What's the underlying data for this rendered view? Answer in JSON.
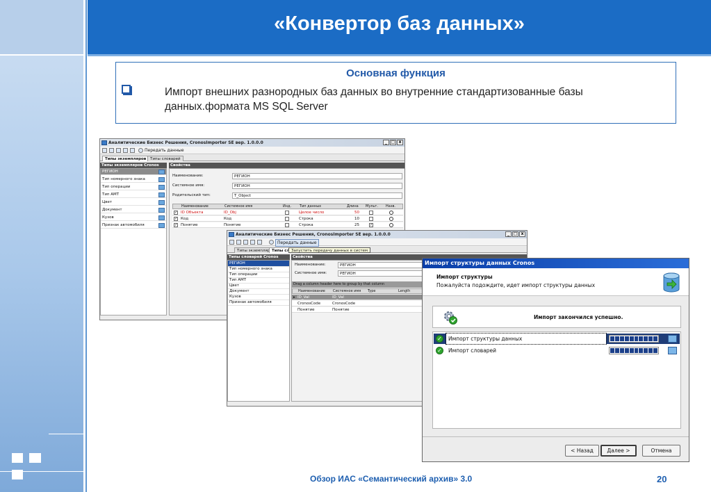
{
  "slide": {
    "title": "«Конвертор баз данных»",
    "box_title": "Основная функция",
    "bullet_text": "Импорт внешних разнородных баз данных во внутренние стандартизованные базы данных.формата MS SQL Server",
    "footer": "Обзор ИАС «Семантический архив» 3.0",
    "page_number": "20"
  },
  "colors": {
    "header": "#1b6cc5",
    "accent": "#2159a8",
    "left_band": "#a9c8ea"
  },
  "win1": {
    "title": "Аналитические Бизнес Решения, CronosImporter SE вер. 1.0.0.0",
    "toolbar_action": "Передать данные",
    "tabs": [
      "Типы экземпляров",
      "Типы словарей"
    ],
    "left_header": "Типы экземпляров Cronos",
    "items": [
      "РЕГИОН",
      "Тип номерного знака",
      "Тип операции",
      "Тип АМТ",
      "Цвет",
      "Документ",
      "Кузов",
      "Признак автомобиля"
    ],
    "props_header": "Свойства",
    "props": [
      {
        "label": "Наименование:",
        "value": "РЕГИОН"
      },
      {
        "label": "Системное имя:",
        "value": "РЕГИОН"
      },
      {
        "label": "Родительский тип:",
        "value": "T_Object"
      }
    ],
    "grid_headers": [
      "Наименование",
      "Системное имя",
      "Инд.",
      "Тип данных",
      "Длина",
      "Мульт.",
      "Назв."
    ],
    "grid_rows": [
      {
        "name": "ID Объекта",
        "sys": "ID_Obj",
        "type": "Целое число",
        "len": "50"
      },
      {
        "name": "Код",
        "sys": "Код",
        "type": "Строка",
        "len": "10"
      },
      {
        "name": "Понятие",
        "sys": "Понятие",
        "type": "Строка",
        "len": "25"
      }
    ]
  },
  "win2": {
    "title": "Аналитические Бизнес Решения, CronosImporter SE вер. 1.0.0.0",
    "toolbar_action": "Передать данные",
    "tabs": [
      "Типы экземпляров",
      "Типы слов"
    ],
    "tooltip": "Запустить передачу данных в систем",
    "left_header": "Типы словарей Cronos",
    "items": [
      "РЕГИОН",
      "Тип номерного знака",
      "Тип операции",
      "Тип АМТ",
      "Цвет",
      "Документ",
      "Кузов",
      "Признак автомобиля"
    ],
    "props_header": "Свойства",
    "props": [
      {
        "label": "Наименование:",
        "value": "РЕГИОН"
      },
      {
        "label": "Системное имя:",
        "value": "РЕГИОН"
      }
    ],
    "group_hint": "Drag a column header here to group by that column",
    "grid_headers": [
      "Наименование",
      "Системное имя",
      "Type",
      "Length"
    ],
    "grid_rows": [
      {
        "name": "ID_Val",
        "sys": "ID_Val"
      },
      {
        "name": "CronosCode",
        "sys": "CronosCode"
      },
      {
        "name": "Понятие",
        "sys": "Понятие"
      }
    ]
  },
  "dialog": {
    "title": "Импорт структуры данных Cronos",
    "heading": "Импорт структуры",
    "subheading": "Пожалуйста подождите, идет импорт структуры данных",
    "status": "Импорт закончился успешно.",
    "tasks": [
      {
        "label": "Импорт структуры данных",
        "progress": 1.0
      },
      {
        "label": "Импорт словарей",
        "progress": 1.0
      }
    ],
    "buttons": {
      "back": "< Назад",
      "next": "Далее >",
      "cancel": "Отмена"
    }
  }
}
